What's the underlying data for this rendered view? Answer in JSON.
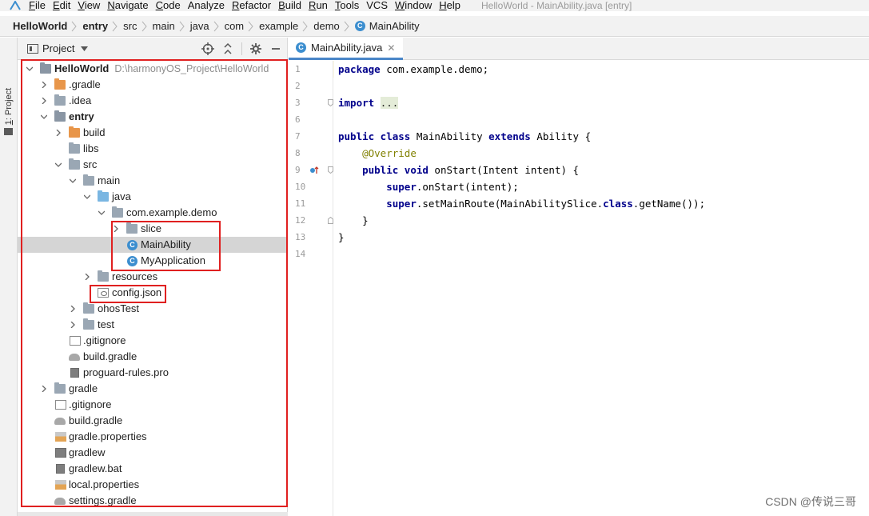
{
  "menu": {
    "items": [
      {
        "mn": "F",
        "rest": "ile"
      },
      {
        "mn": "E",
        "rest": "dit"
      },
      {
        "mn": "V",
        "rest": "iew"
      },
      {
        "mn": "N",
        "rest": "avigate"
      },
      {
        "mn": "C",
        "rest": "ode"
      },
      {
        "mn": "",
        "rest": "Analyze"
      },
      {
        "mn": "R",
        "rest": "efactor"
      },
      {
        "mn": "B",
        "rest": "uild"
      },
      {
        "mn": "R",
        "rest": "un"
      },
      {
        "mn": "T",
        "rest": "ools"
      },
      {
        "mn": "",
        "rest": "VCS"
      },
      {
        "mn": "W",
        "rest": "indow"
      },
      {
        "mn": "H",
        "rest": "elp"
      }
    ],
    "window_title": "HelloWorld - MainAbility.java [entry]"
  },
  "breadcrumb": [
    "HelloWorld",
    "entry",
    "src",
    "main",
    "java",
    "com",
    "example",
    "demo",
    "MainAbility"
  ],
  "stripe": {
    "tab_mn": "1",
    "tab_rest": ": Project"
  },
  "project_panel": {
    "title": "Project",
    "tree": [
      {
        "label": "HelloWorld",
        "path": "D:\\harmonyOS_Project\\HelloWorld",
        "bold": true
      },
      {
        "label": ".gradle"
      },
      {
        "label": ".idea"
      },
      {
        "label": "entry",
        "bold": true
      },
      {
        "label": "build"
      },
      {
        "label": "libs"
      },
      {
        "label": "src"
      },
      {
        "label": "main"
      },
      {
        "label": "java"
      },
      {
        "label": "com.example.demo"
      },
      {
        "label": "slice"
      },
      {
        "label": "MainAbility",
        "selected": true
      },
      {
        "label": "MyApplication"
      },
      {
        "label": "resources"
      },
      {
        "label": "config.json"
      },
      {
        "label": "ohosTest"
      },
      {
        "label": "test"
      },
      {
        "label": ".gitignore"
      },
      {
        "label": "build.gradle"
      },
      {
        "label": "proguard-rules.pro"
      },
      {
        "label": "gradle"
      },
      {
        "label": ".gitignore"
      },
      {
        "label": "build.gradle"
      },
      {
        "label": "gradle.properties"
      },
      {
        "label": "gradlew"
      },
      {
        "label": "gradlew.bat"
      },
      {
        "label": "local.properties"
      },
      {
        "label": "settings.gradle"
      }
    ]
  },
  "editor": {
    "tab_label": "MainAbility.java",
    "line_numbers": [
      "1",
      "2",
      "3",
      "6",
      "7",
      "8",
      "9",
      "10",
      "11",
      "12",
      "13",
      "14"
    ],
    "code": {
      "l1_kw": "package",
      "l1_rest": " com.example.demo;",
      "l3_kw": "import",
      "l3_fold": "...",
      "l7_kw1": "public class",
      "l7_mid": " MainAbility ",
      "l7_kw2": "extends",
      "l7_rest": " Ability {",
      "l8_ann": "@Override",
      "l9_kw": "public void",
      "l9_rest": " onStart(Intent intent) {",
      "l10_kw": "super",
      "l10_rest": ".onStart(intent);",
      "l11_kw": "super",
      "l11_mid": ".setMainRoute(MainAbilitySlice.",
      "l11_kw2": "class",
      "l11_rest": ".getName());",
      "l12": "}",
      "l13": "}"
    }
  },
  "watermark": "CSDN @传说三哥",
  "colors": {
    "highlight_box": "#e02020",
    "class_icon": "#3c8ecf",
    "line_highlight": "#fefae5"
  }
}
